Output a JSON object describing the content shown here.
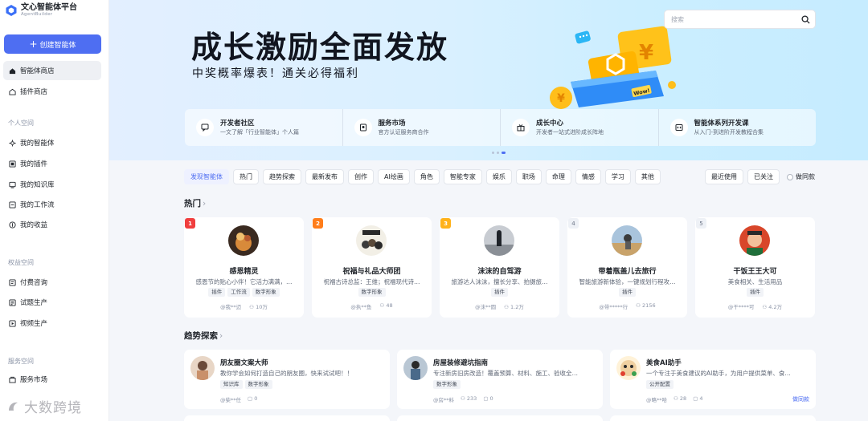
{
  "app": {
    "title": "文心智能体平台",
    "subtitle": "AgentBuilder"
  },
  "sidebar": {
    "create_label": "创建智能体",
    "main_items": [
      {
        "label": "智能体商店"
      },
      {
        "label": "插件商店"
      }
    ],
    "personal": {
      "heading": "个人空间",
      "items": [
        {
          "label": "我的智能体"
        },
        {
          "label": "我的插件"
        },
        {
          "label": "我的知识库"
        },
        {
          "label": "我的工作流"
        },
        {
          "label": "我的收益"
        }
      ]
    },
    "rights": {
      "heading": "权益空间",
      "items": [
        {
          "label": "付费咨询"
        },
        {
          "label": "试题生产"
        },
        {
          "label": "视频生产"
        }
      ]
    },
    "service": {
      "heading": "服务空间",
      "items": [
        {
          "label": "服务市场"
        }
      ]
    }
  },
  "banner": {
    "title": "成长激励全面发放",
    "subtitle": "中奖概率爆表！通关必得福利",
    "search_placeholder": "搜索",
    "wow": "Wow!",
    "quick": [
      {
        "title": "开发者社区",
        "desc": "一文了解「行业智能体」个人篇"
      },
      {
        "title": "服务市场",
        "desc": "官方认证服务商合作"
      },
      {
        "title": "成长中心",
        "desc": "开发者一站式进阶成长阵地"
      },
      {
        "title": "智能体系列开发课",
        "desc": "从入门-到进阶开发教程合集"
      }
    ]
  },
  "tabs": [
    "发现智能体",
    "热门",
    "趋势探索",
    "最新发布",
    "创作",
    "AI绘画",
    "角色",
    "智能专家",
    "娱乐",
    "职场",
    "命理",
    "情感",
    "学习",
    "其他"
  ],
  "tabs_right": {
    "recent": "最近使用",
    "followed": "已关注",
    "same": "做同款"
  },
  "hot": {
    "title": "热门",
    "cards": [
      {
        "rank": "1",
        "rank_color": "#f03e3e",
        "name": "感恩精灵",
        "desc": "感恩节的贴心小伴！它活力满满，…",
        "tags": [
          "插件",
          "工作流",
          "数字形象"
        ],
        "author": "@我**迈",
        "users": "10万"
      },
      {
        "rank": "2",
        "rank_color": "#ff7d1a",
        "name": "祝福与礼品大师团",
        "desc": "祝福古诗总监：王维；祝福现代诗…",
        "tags": [
          "数字形象"
        ],
        "author": "@执**鱼",
        "users": "48"
      },
      {
        "rank": "3",
        "rank_color": "#ffb21a",
        "name": "沫沫的自驾游",
        "desc": "旅游达人沫沫，擅长分享、拍摄旅…",
        "tags": [
          "插件"
        ],
        "author": "@沫**圆",
        "users": "1.2万"
      },
      {
        "rank": "4",
        "rank_color": "",
        "name": "带着瓶盖儿去旅行",
        "desc": "智能旅游新体验，一键规划行程攻…",
        "tags": [
          "插件"
        ],
        "author": "@带*****行",
        "users": "2156"
      },
      {
        "rank": "5",
        "rank_color": "",
        "name": "干饭王王大可",
        "desc": "美食相关、生活用品",
        "tags": [
          "插件"
        ],
        "author": "@干****可",
        "users": "4.2万"
      }
    ]
  },
  "trend": {
    "title": "趋势探索",
    "cards": [
      {
        "name": "朋友圈文案大师",
        "desc": "教你学会如何打造自己的朋友圈，快来试试吧！！",
        "tags": [
          "知识库",
          "数字形象"
        ],
        "author": "@柴**任",
        "users": "",
        "chats": "0",
        "link": ""
      },
      {
        "name": "房屋装修避坑指南",
        "desc": "专注新房旧房改造！覆盖预算、材料、施工、验收全…",
        "tags": [
          "数字形象"
        ],
        "author": "@房**料",
        "users": "233",
        "chats": "0",
        "link": ""
      },
      {
        "name": "美食AI助手",
        "desc": "一个专注于美食建议的AI助手，为用户提供菜单、食…",
        "tags": [
          "公开配置"
        ],
        "author": "@略**哈",
        "users": "28",
        "chats": "4",
        "link": "做同款"
      }
    ]
  },
  "watermark": "大数跨境"
}
